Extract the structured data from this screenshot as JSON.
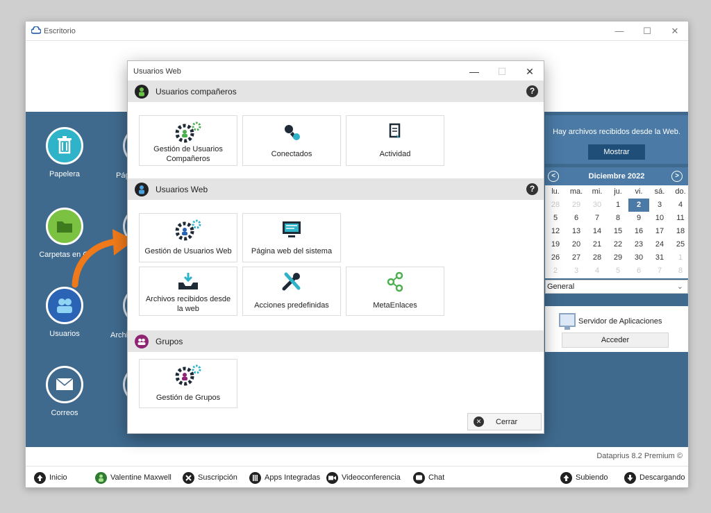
{
  "window": {
    "title": "Escritorio",
    "minimize": "—",
    "maximize": "☐",
    "close": "✕"
  },
  "desktop": {
    "icons": [
      {
        "label": "Papelera"
      },
      {
        "label": "Carpetas en Cl"
      },
      {
        "label": "Usuarios"
      },
      {
        "label": "Correos"
      }
    ],
    "partial_labels": [
      "Pág",
      "Archi"
    ]
  },
  "notice": {
    "text": "Hay archivos recibidos desde la Web.",
    "button": "Mostrar"
  },
  "calendar": {
    "month": "Diciembre 2022",
    "prev": "<",
    "next": ">",
    "weekdays": [
      "lu.",
      "ma.",
      "mi.",
      "ju.",
      "vi.",
      "sá.",
      "do."
    ],
    "days": [
      "28",
      "29",
      "30",
      "1",
      "2",
      "3",
      "4",
      "5",
      "6",
      "7",
      "8",
      "9",
      "10",
      "11",
      "12",
      "13",
      "14",
      "15",
      "16",
      "17",
      "18",
      "19",
      "20",
      "21",
      "22",
      "23",
      "24",
      "25",
      "26",
      "27",
      "28",
      "29",
      "30",
      "31",
      "1",
      "2",
      "3",
      "4",
      "5",
      "6",
      "7",
      "8"
    ],
    "today": "2",
    "select_value": "General"
  },
  "server": {
    "label": "Servidor de Aplicaciones",
    "button": "Acceder"
  },
  "version": "Dataprius 8.2 Premium ©",
  "taskbar": {
    "inicio": "Inicio",
    "user": "Valentine Maxwell",
    "suscripcion": "Suscripción",
    "apps": "Apps Integradas",
    "video": "Videoconferencia",
    "chat": "Chat",
    "subiendo": "Subiendo",
    "descargando": "Descargando"
  },
  "dialog": {
    "title": "Usuarios Web",
    "minimize": "—",
    "maximize": "☐",
    "close": "✕",
    "help": "?",
    "sections": {
      "companeros": {
        "title": "Usuarios compañeros",
        "cards": [
          "Gestión de Usuarios Compañeros",
          "Conectados",
          "Actividad"
        ]
      },
      "web": {
        "title": "Usuarios Web",
        "cards": [
          "Gestión de Usuarios Web",
          "Página web del sistema",
          "Archivos recibidos desde la web",
          "Acciones predefinidas",
          "MetaEnlaces"
        ]
      },
      "grupos": {
        "title": "Grupos",
        "cards": [
          "Gestión de Grupos"
        ]
      }
    },
    "close_button": "Cerrar"
  },
  "colors": {
    "desktop": "#3f6a8e",
    "accent": "#4a7aa5",
    "green": "#4caf50",
    "teal": "#2fb3c8",
    "orange": "#f07a1a",
    "purple": "#8e2472"
  }
}
